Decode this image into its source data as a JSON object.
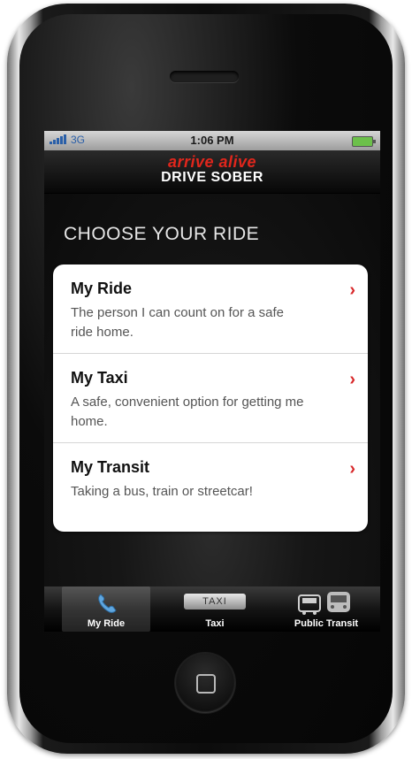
{
  "status_bar": {
    "carrier": "3G",
    "time": "1:06 PM"
  },
  "app_header": {
    "logo_top": "arrive alive",
    "logo_bottom": "DRIVE SOBER"
  },
  "page_title": "CHOOSE YOUR RIDE",
  "rides": [
    {
      "title": "My Ride",
      "description": "The person I can count on for a safe ride home."
    },
    {
      "title": "My Taxi",
      "description": "A safe, convenient option for getting me home."
    },
    {
      "title": "My Transit",
      "description": "Taking a bus, train or streetcar!"
    }
  ],
  "tabs": [
    {
      "label": "My Ride",
      "icon": "phone-icon",
      "active": true
    },
    {
      "label": "Taxi",
      "icon": "taxi-sign-icon",
      "sign_text": "TAXI",
      "active": false
    },
    {
      "label": "Public Transit",
      "icon": "transit-icon",
      "active": false
    }
  ],
  "colors": {
    "accent_red": "#e1261c",
    "tab_icon_blue": "#5fa6df"
  }
}
